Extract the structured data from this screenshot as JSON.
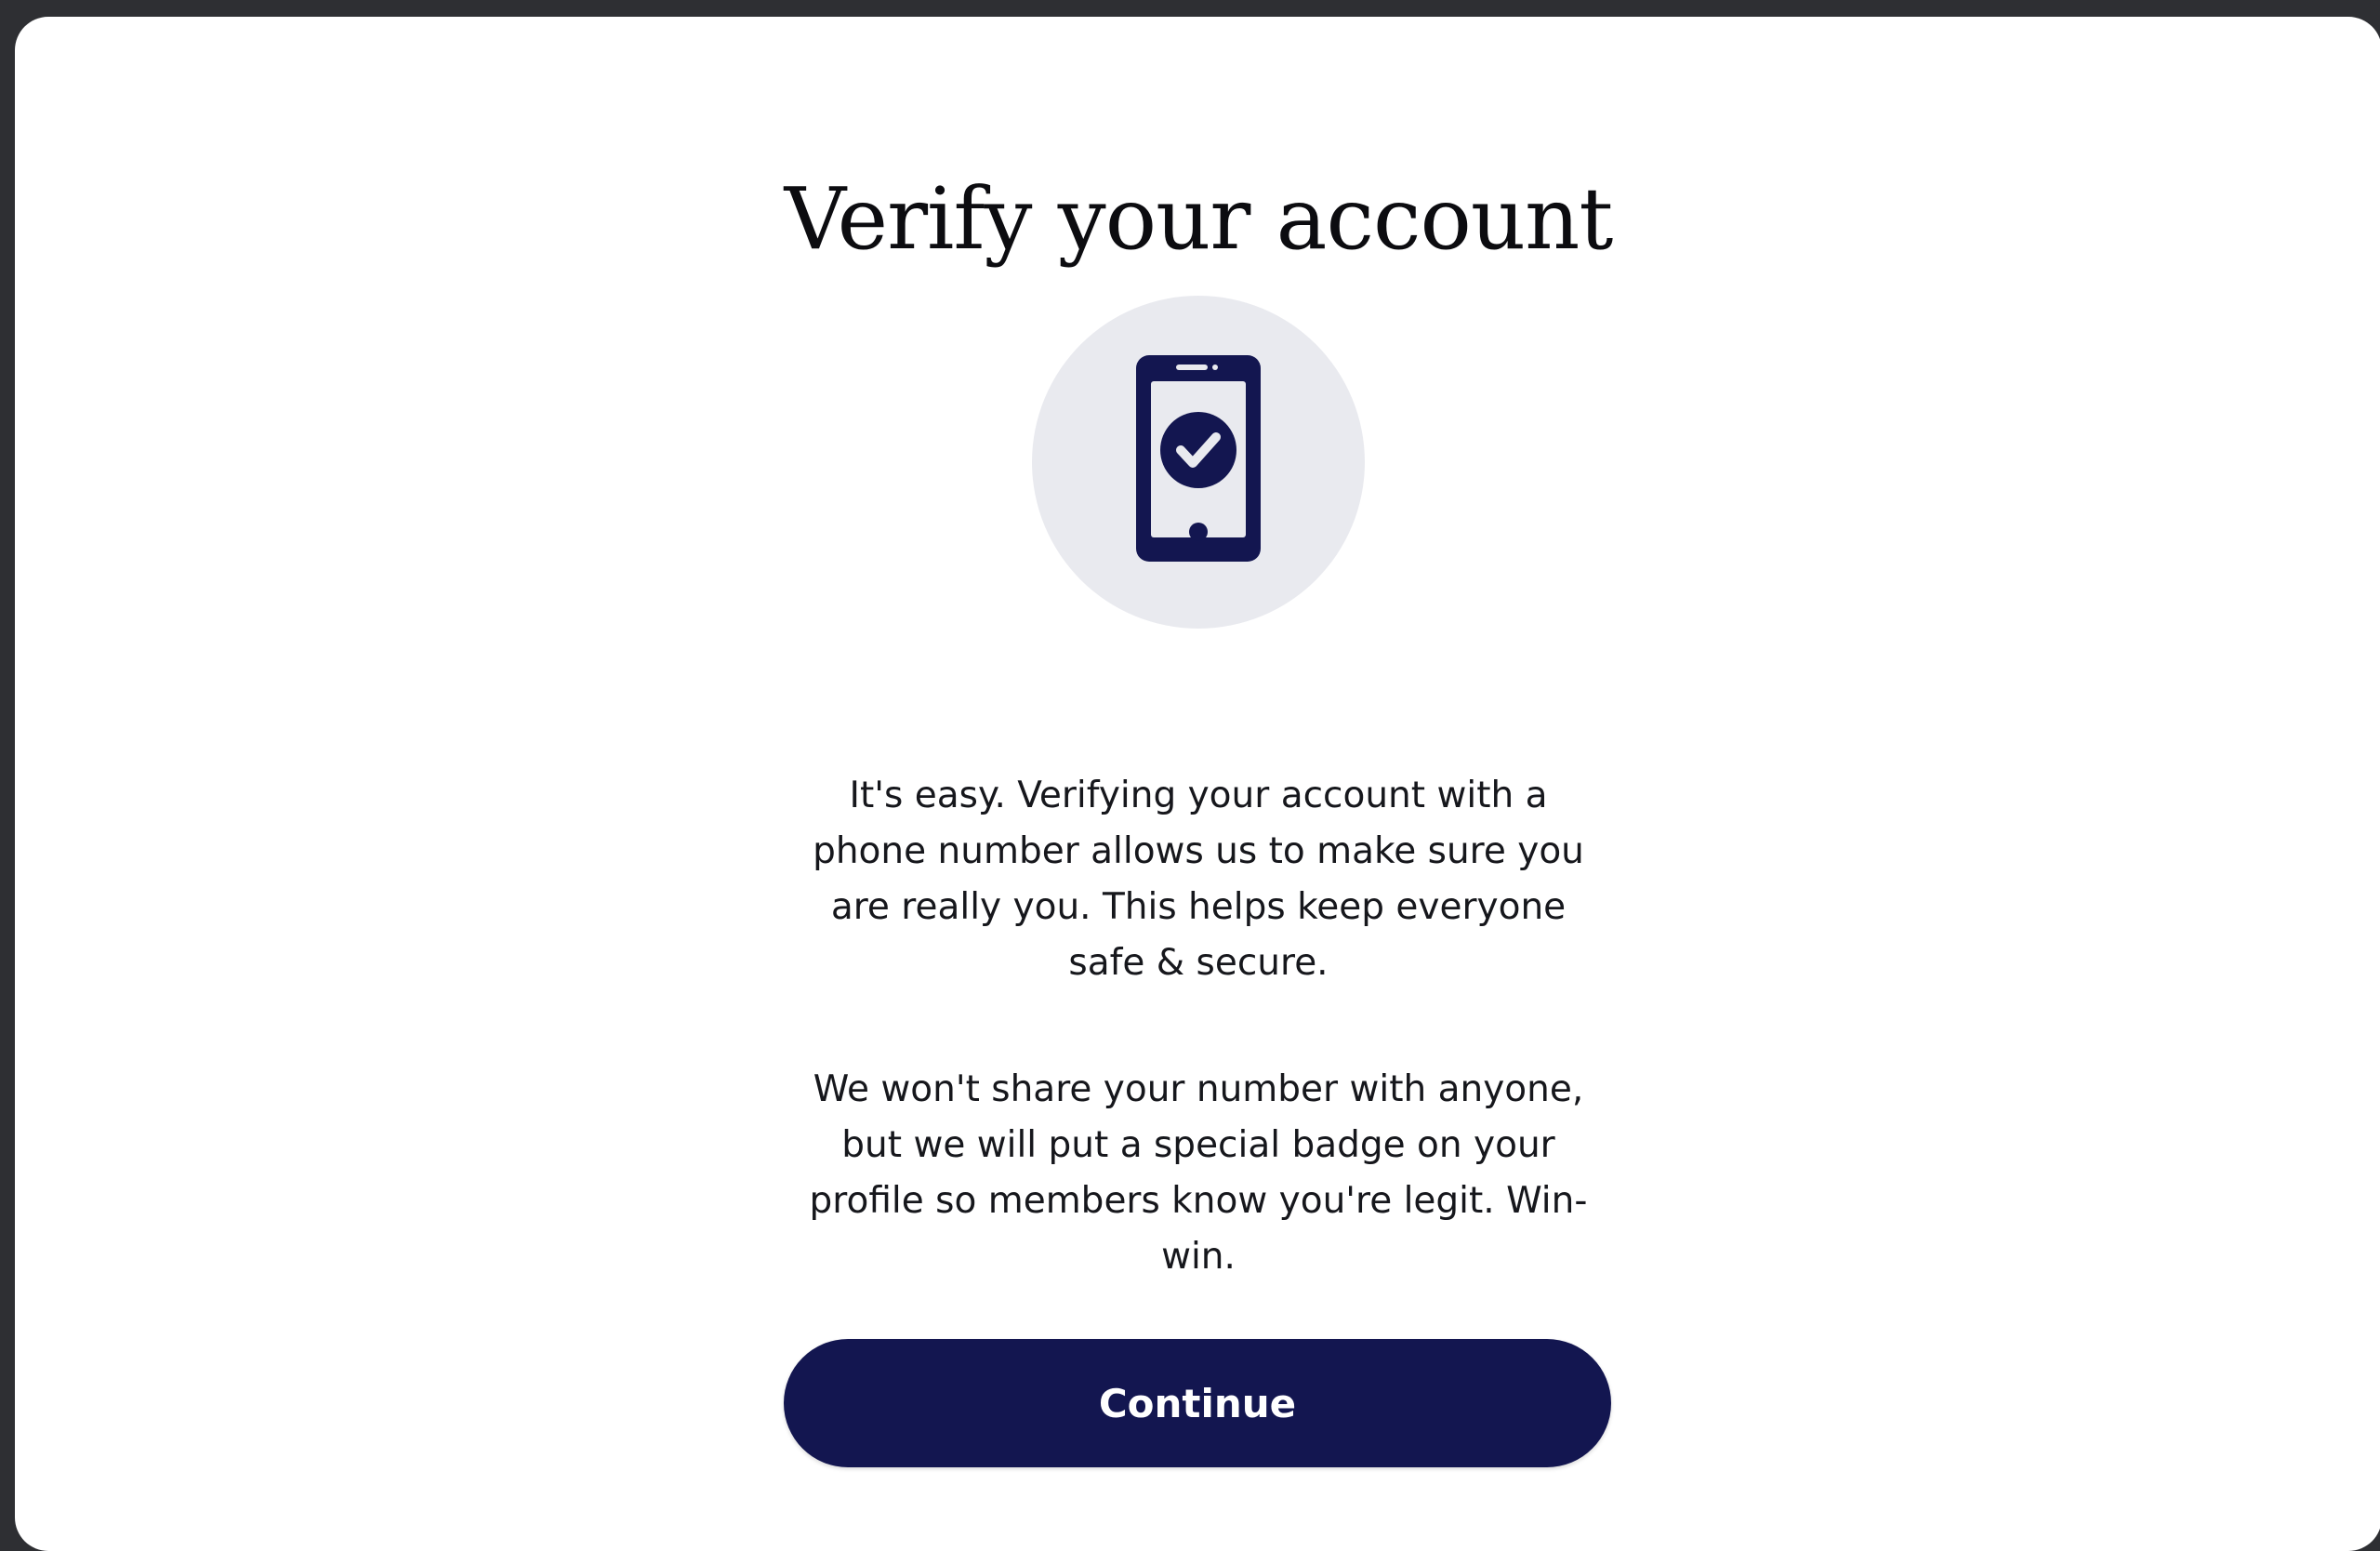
{
  "modal": {
    "title": "Verify your account",
    "icon": "phone-check-icon",
    "paragraph_1": "It's easy. Verifying your account with a phone number allows us to make sure you are really you. This helps keep everyone safe & secure.",
    "paragraph_2": "We won't share your number with anyone, but we will put a special badge on your profile so members know you're legit. Win-win.",
    "continue_label": "Continue"
  },
  "colors": {
    "accent": "#131650",
    "icon_background": "#e9eaef",
    "backdrop": "#2e2f33"
  }
}
